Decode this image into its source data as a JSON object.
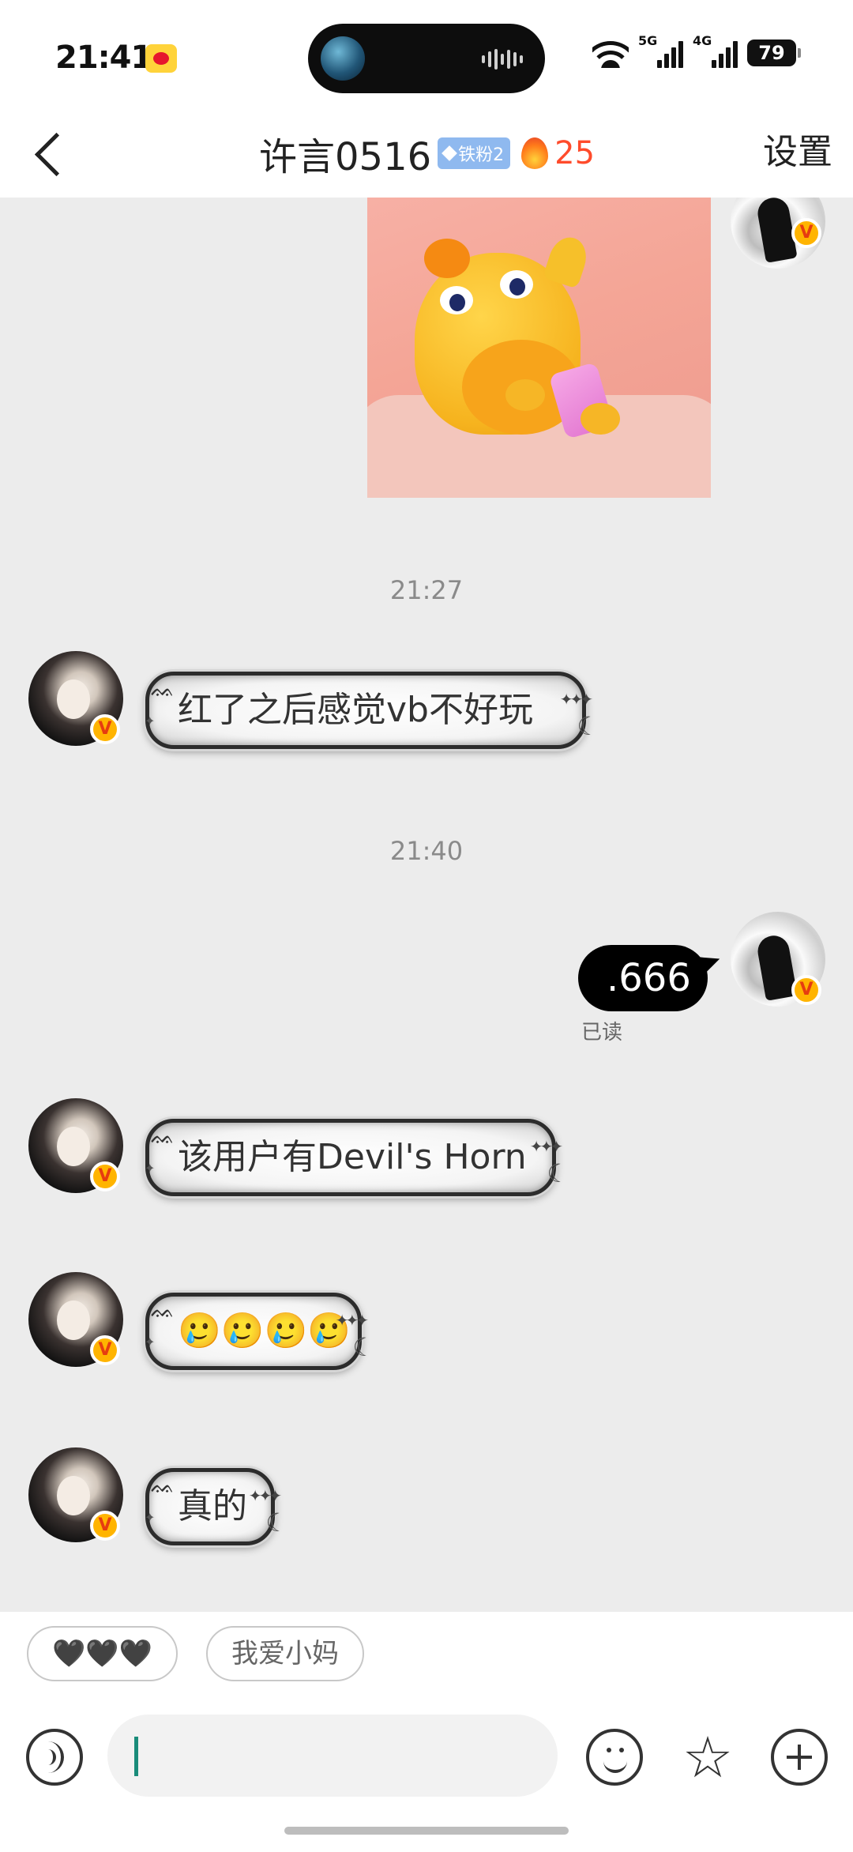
{
  "status_bar": {
    "time": "21:41",
    "network_a": "5G",
    "network_b": "4G",
    "battery": "79"
  },
  "header": {
    "title": "许言0516",
    "fan_badge": "铁粉2",
    "fire_count": "25",
    "settings": "设置"
  },
  "chat": {
    "messages": [
      {
        "type": "time",
        "text": "21:27"
      },
      {
        "type": "incoming",
        "text": "红了之后感觉vb不好玩"
      },
      {
        "type": "time",
        "text": "21:40"
      },
      {
        "type": "outgoing",
        "text": ".666",
        "status": "已读"
      },
      {
        "type": "incoming",
        "text": "该用户有Devil's Horn"
      },
      {
        "type": "incoming",
        "text": "🥲🥲🥲🥲"
      },
      {
        "type": "incoming",
        "text": "真的"
      }
    ],
    "verified_mark": "V"
  },
  "quick_replies": [
    "🖤🖤🖤",
    "我爱小妈"
  ],
  "composer": {
    "input_value": ""
  }
}
